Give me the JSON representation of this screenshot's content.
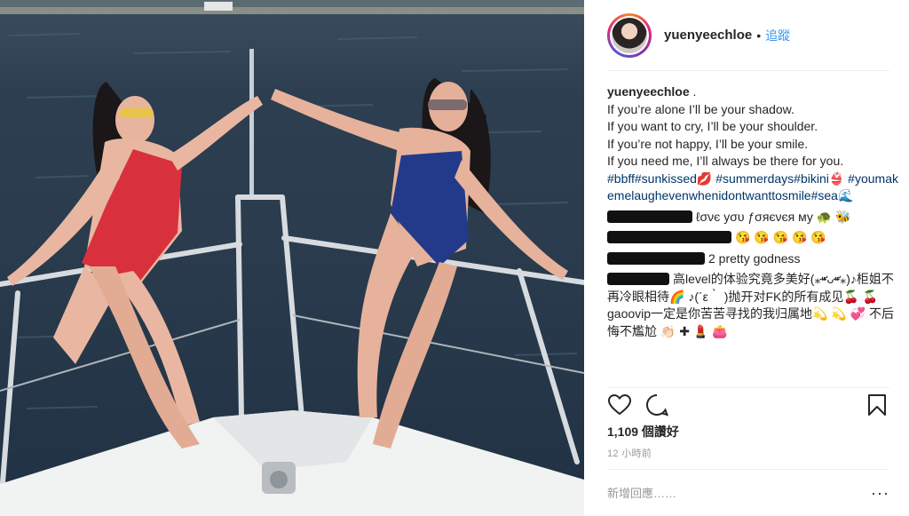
{
  "post": {
    "username": "yuenyeechloe",
    "header_separator": "•",
    "follow_label": "追蹤"
  },
  "caption": {
    "username": "yuenyeechloe",
    "first_line_suffix": " .",
    "lines": [
      "If you’re alone I’ll be your shadow.",
      "If you want to cry, I’ll be your shoulder.",
      "If you’re not happy, I’ll be your smile.",
      "If you need me, I’ll always be there for you."
    ],
    "hashtags": "#bbff#sunkissed💋 #summerdays#bikini👙 #youmakemelaughevenwhenidontwanttosmile#sea🌊"
  },
  "comments": [
    {
      "text": "ℓσνє уσυ ƒσяєνєя му 🐢 🐝"
    },
    {
      "text": "😘 😘 😘 😘 😘"
    },
    {
      "text": "2 pretty godness"
    },
    {
      "text": "高level的体验究竟多美好(⁎⁍̴̛ᴗ⁍̴̛⁎)♪柜姐不再冷眼相待🌈 ♪(´ε｀ )抛开对FK的所有成见🍒 🍒 gaoovip一定是你苦苦寻找的我归属地💫 💫 💞 不后悔不尷尬 👏🏻 ✚ 💄 👛"
    }
  ],
  "likes": "1,109 個讚好",
  "timestamp": "12 小時前",
  "comment_input": {
    "placeholder": "新增回應……",
    "more_label": "···"
  },
  "icons": {
    "like": "heart-icon",
    "comment": "comment-bubble-icon",
    "save": "bookmark-icon",
    "more": "more-options-icon"
  },
  "colors": {
    "link": "#3897f0",
    "hashtag": "#003569",
    "text": "#262626",
    "muted": "#999999",
    "border": "#efefef"
  }
}
